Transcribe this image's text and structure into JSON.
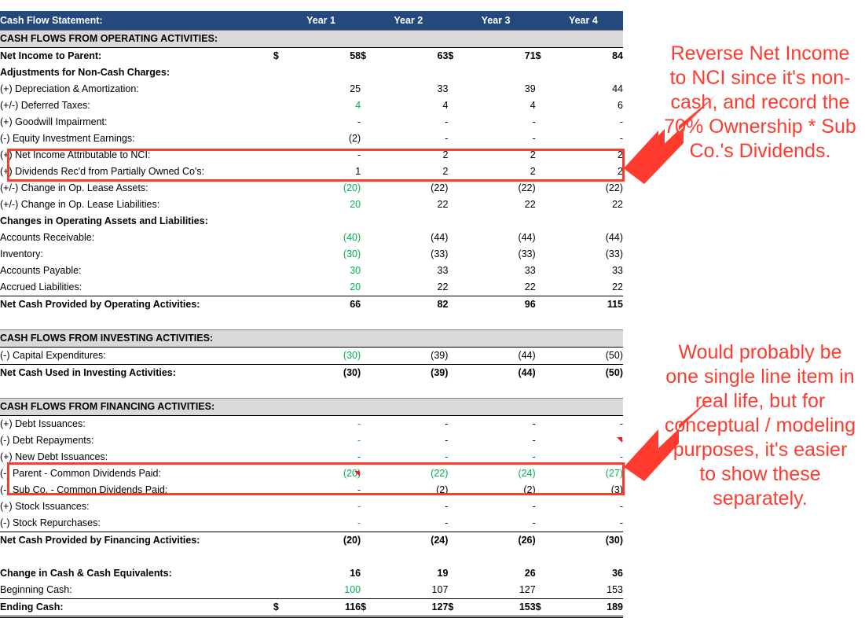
{
  "colors": {
    "header_navy": "#23497D",
    "band_grey": "#D9D9D9",
    "annotation_red": "#FF3B30",
    "input_green": "#00B050",
    "link_blue": "#0033CC"
  },
  "table": {
    "title": "Cash Flow Statement:",
    "columns": [
      "Year 1",
      "Year 2",
      "Year 3",
      "Year 4"
    ],
    "sections": [
      {
        "band": "CASH FLOWS FROM OPERATING ACTIVITIES:",
        "rows": [
          {
            "label": "Net Income to Parent:",
            "indent": 1,
            "bold": true,
            "currency": true,
            "values": [
              "58",
              "63",
              "71",
              "84"
            ],
            "colors": [
              "black",
              "black",
              "black",
              "black"
            ]
          },
          {
            "label": "Adjustments for Non-Cash Charges:",
            "indent": 1,
            "bold": true,
            "values": [
              "",
              "",
              "",
              ""
            ]
          },
          {
            "label": "(+) Depreciation & Amortization:",
            "indent": 2,
            "values": [
              "25",
              "33",
              "39",
              "44"
            ],
            "colors": [
              "black",
              "black",
              "black",
              "black"
            ]
          },
          {
            "label": "(+/-) Deferred Taxes:",
            "indent": 2,
            "values": [
              "4",
              "4",
              "4",
              "6"
            ],
            "colors": [
              "green",
              "black",
              "black",
              "black"
            ]
          },
          {
            "label": "(+) Goodwill Impairment:",
            "indent": 2,
            "values": [
              "-",
              "-",
              "-",
              "-"
            ],
            "colors": [
              "black",
              "black",
              "black",
              "black"
            ]
          },
          {
            "label": "(-) Equity Investment Earnings:",
            "indent": 2,
            "values": [
              "(2)",
              "-",
              "-",
              "-"
            ],
            "colors": [
              "black",
              "black",
              "black",
              "black"
            ]
          },
          {
            "label": "(+) Net Income Attributable to NCI:",
            "indent": 2,
            "values": [
              "-",
              "2",
              "2",
              "2"
            ],
            "colors": [
              "black",
              "black",
              "black",
              "black"
            ]
          },
          {
            "label": "(+) Dividends Rec'd from Partially Owned Co's:",
            "indent": 2,
            "values": [
              "1",
              "2",
              "2",
              "2"
            ],
            "colors": [
              "black",
              "black",
              "black",
              "black"
            ]
          },
          {
            "label": "(+/-) Change in Op. Lease Assets:",
            "indent": 2,
            "values": [
              "(20)",
              "(22)",
              "(22)",
              "(22)"
            ],
            "colors": [
              "green",
              "black",
              "black",
              "black"
            ]
          },
          {
            "label": "(+/-) Change in Op. Lease Liabilities:",
            "indent": 2,
            "values": [
              "20",
              "22",
              "22",
              "22"
            ],
            "colors": [
              "green",
              "black",
              "black",
              "black"
            ]
          },
          {
            "label": "Changes in Operating Assets and Liabilities:",
            "indent": 1,
            "bold": true,
            "values": [
              "",
              "",
              "",
              ""
            ]
          },
          {
            "label": "Accounts Receivable:",
            "indent": 2,
            "values": [
              "(40)",
              "(44)",
              "(44)",
              "(44)"
            ],
            "colors": [
              "green",
              "black",
              "black",
              "black"
            ]
          },
          {
            "label": "Inventory:",
            "indent": 2,
            "values": [
              "(30)",
              "(33)",
              "(33)",
              "(33)"
            ],
            "colors": [
              "green",
              "black",
              "black",
              "black"
            ]
          },
          {
            "label": "Accounts Payable:",
            "indent": 2,
            "values": [
              "30",
              "33",
              "33",
              "33"
            ],
            "colors": [
              "green",
              "black",
              "black",
              "black"
            ]
          },
          {
            "label": "Accrued Liabilities:",
            "indent": 2,
            "values": [
              "20",
              "22",
              "22",
              "22"
            ],
            "colors": [
              "green",
              "black",
              "black",
              "black"
            ]
          },
          {
            "label": "Net Cash Provided by Operating Activities:",
            "indent": 1,
            "bold": true,
            "total": true,
            "values": [
              "66",
              "82",
              "96",
              "115"
            ],
            "colors": [
              "black",
              "black",
              "black",
              "black"
            ]
          }
        ]
      },
      {
        "band": "CASH FLOWS FROM INVESTING ACTIVITIES:",
        "rows": [
          {
            "label": "(-) Capital Expenditures:",
            "indent": 2,
            "values": [
              "(30)",
              "(39)",
              "(44)",
              "(50)"
            ],
            "colors": [
              "green",
              "black",
              "black",
              "black"
            ]
          },
          {
            "label": "Net Cash Used in Investing Activities:",
            "indent": 1,
            "bold": true,
            "total": true,
            "values": [
              "(30)",
              "(39)",
              "(44)",
              "(50)"
            ],
            "colors": [
              "black",
              "black",
              "black",
              "black"
            ]
          }
        ]
      },
      {
        "band": "CASH FLOWS FROM FINANCING ACTIVITIES:",
        "rows": [
          {
            "label": "(+) Debt Issuances:",
            "indent": 2,
            "values": [
              "-",
              "-",
              "-",
              "-"
            ],
            "colors": [
              "green",
              "black",
              "black",
              "black"
            ]
          },
          {
            "label": "(-) Debt Repayments:",
            "indent": 2,
            "values": [
              "-",
              "-",
              "-",
              "-"
            ],
            "colors": [
              "green",
              "black",
              "black",
              "black"
            ]
          },
          {
            "label": "(+) New Debt Issuances:",
            "indent": 2,
            "values": [
              "-",
              "-",
              "-",
              "-"
            ],
            "colors": [
              "blue",
              "blue",
              "blue",
              "blue"
            ]
          },
          {
            "label": "(-) Parent - Common Dividends Paid:",
            "indent": 2,
            "values": [
              "(20)",
              "(22)",
              "(24)",
              "(27)"
            ],
            "colors": [
              "green",
              "green",
              "green",
              "green"
            ]
          },
          {
            "label": "(-) Sub Co. - Common Dividends Paid:",
            "indent": 2,
            "values": [
              "-",
              "(2)",
              "(2)",
              "(3)"
            ],
            "colors": [
              "blue",
              "black",
              "black",
              "black"
            ]
          },
          {
            "label": "(+) Stock Issuances:",
            "indent": 2,
            "values": [
              "-",
              "-",
              "-",
              "-"
            ],
            "colors": [
              "green",
              "black",
              "black",
              "black"
            ]
          },
          {
            "label": "(-) Stock Repurchases:",
            "indent": 2,
            "values": [
              "-",
              "-",
              "-",
              "-"
            ],
            "colors": [
              "green",
              "black",
              "black",
              "black"
            ]
          },
          {
            "label": "Net Cash Provided by Financing Activities:",
            "indent": 1,
            "bold": true,
            "total": true,
            "values": [
              "(20)",
              "(24)",
              "(26)",
              "(30)"
            ],
            "colors": [
              "black",
              "black",
              "black",
              "black"
            ]
          }
        ]
      },
      {
        "band": null,
        "rows": [
          {
            "label": "Change in Cash & Cash Equivalents:",
            "indent": 1,
            "bold": true,
            "values": [
              "16",
              "19",
              "26",
              "36"
            ],
            "colors": [
              "black",
              "black",
              "black",
              "black"
            ]
          },
          {
            "label": "Beginning Cash:",
            "indent": 2,
            "values": [
              "100",
              "107",
              "127",
              "153"
            ],
            "colors": [
              "green",
              "black",
              "black",
              "black"
            ]
          },
          {
            "label": "Ending Cash:",
            "indent": 1,
            "bold": true,
            "grandtotal": true,
            "currency": true,
            "values": [
              "116",
              "127",
              "153",
              "189"
            ],
            "colors": [
              "black",
              "black",
              "black",
              "black"
            ]
          }
        ]
      }
    ]
  },
  "annotations": [
    {
      "id": "annot-nci",
      "text": "Reverse Net Income to NCI since it's non-cash, and record the 70% Ownership * Sub Co.'s Dividends."
    },
    {
      "id": "annot-dividends",
      "text": "Would probably be one single line item in real life, but for conceptual / modeling purposes, it's easier to show these separately."
    }
  ],
  "currency_symbol": "$"
}
